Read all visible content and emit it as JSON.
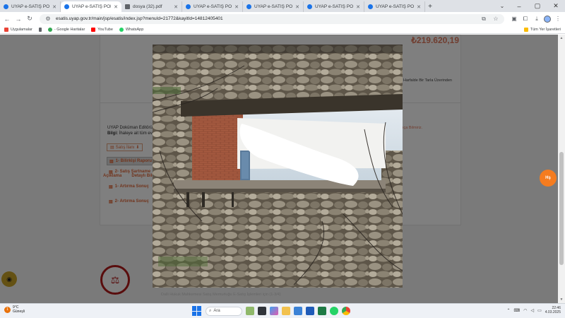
{
  "browser": {
    "tabs": [
      {
        "title": "UYAP e-SATIŞ PORTALI",
        "active": false,
        "icon": "uyap-icon"
      },
      {
        "title": "UYAP e-SATIŞ PORTALI",
        "active": true,
        "icon": "uyap-icon"
      },
      {
        "title": "dosya (32).pdf",
        "active": false,
        "icon": "pdf-icon"
      },
      {
        "title": "UYAP e-SATIŞ PORTALI",
        "active": false,
        "icon": "uyap-icon"
      },
      {
        "title": "UYAP e-SATIŞ PORTALI",
        "active": false,
        "icon": "uyap-icon"
      },
      {
        "title": "UYAP e-SATIŞ PORTALI",
        "active": false,
        "icon": "uyap-icon"
      },
      {
        "title": "UYAP e-SATIŞ PORTALI",
        "active": false,
        "icon": "uyap-icon"
      }
    ],
    "url": "esatis.uyap.gov.tr/main/jsp/esatis/index.jsp?menuId=21772&kayitId=14812405401",
    "bookmarks": [
      {
        "label": "Uygulamalar"
      },
      {
        "label": "- Google Haritalar"
      },
      {
        "label": "YouTube"
      },
      {
        "label": "WhatsApp"
      }
    ],
    "bookmarks_right": "Tüm Yer İşaretleri"
  },
  "page": {
    "price": "₺219.620,19",
    "description_right": "Harfalde Bir Tarla Üzerinden",
    "tabs": [
      "Açıklama",
      "Detaylı Bilgi"
    ],
    "editor_line1": "UYAP Doküman Editörü",
    "editor_line2_bold": "Bilgi:",
    "editor_line2": " İhaleye ait tüm evr",
    "warning_right": "ıça Bilmiriz.",
    "sale_button": "Satış İlanı",
    "docs": [
      {
        "label": "1- Bilirkişi Raporu",
        "selected": true
      },
      {
        "label": "2- Satış Şartname",
        "selected": false
      },
      {
        "label": "1- Artırma Sonuç",
        "selected": false
      },
      {
        "label": "2- Artırma Sonuç",
        "selected": false
      }
    ],
    "fab_label": "Hş",
    "footer_text": "Dalli Hukuk Mahkemesi Satış Memurluğu E-Satış İşlemleri için (1-3/4)"
  },
  "taskbar": {
    "weather_badge": "1",
    "temp": "9°C",
    "condition": "Güneşli",
    "search_placeholder": "Ara",
    "time": "22:46",
    "date": "4.03.2025"
  },
  "colors": {
    "accent": "#e2693a",
    "fab": "#f57c1f",
    "browser_blue": "#1a73e8"
  }
}
